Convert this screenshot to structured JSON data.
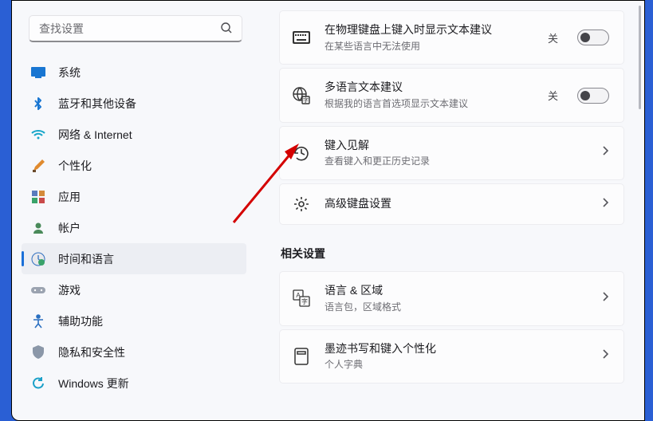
{
  "search": {
    "placeholder": "查找设置"
  },
  "sidebar": {
    "items": [
      {
        "label": "系统"
      },
      {
        "label": "蓝牙和其他设备"
      },
      {
        "label": "网络 & Internet"
      },
      {
        "label": "个性化"
      },
      {
        "label": "应用"
      },
      {
        "label": "帐户"
      },
      {
        "label": "时间和语言"
      },
      {
        "label": "游戏"
      },
      {
        "label": "辅助功能"
      },
      {
        "label": "隐私和安全性"
      },
      {
        "label": "Windows 更新"
      }
    ]
  },
  "main": {
    "cards": [
      {
        "title": "在物理键盘上键入时显示文本建议",
        "sub": "在某些语言中无法使用",
        "state": "关"
      },
      {
        "title": "多语言文本建议",
        "sub": "根据我的语言首选项显示文本建议",
        "state": "关"
      },
      {
        "title": "键入见解",
        "sub": "查看键入和更正历史记录"
      },
      {
        "title": "高级键盘设置"
      }
    ],
    "relatedHeader": "相关设置",
    "related": [
      {
        "title": "语言 & 区域",
        "sub": "语言包，区域格式"
      },
      {
        "title": "墨迹书写和键入个性化",
        "sub": "个人字典"
      }
    ]
  }
}
